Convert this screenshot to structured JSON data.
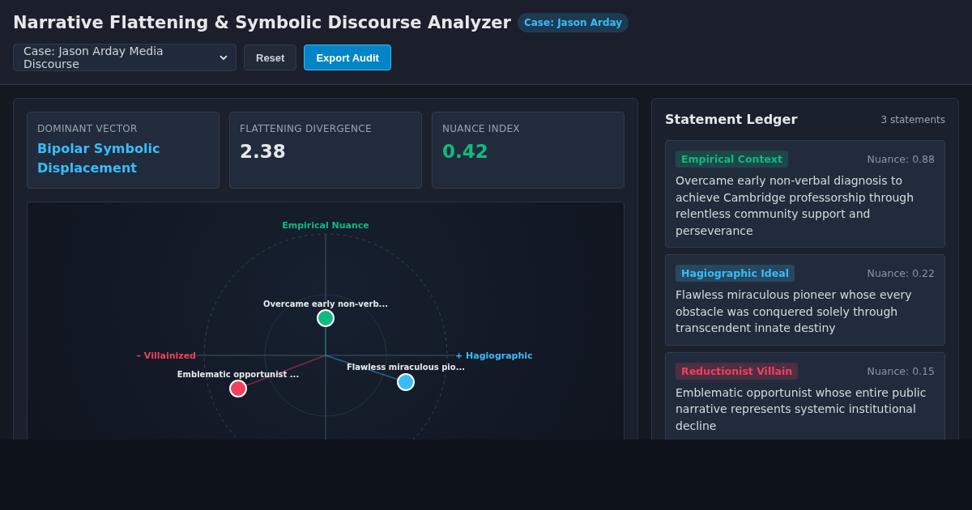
{
  "header": {
    "title": "Narrative Flattening & Symbolic Discourse Analyzer",
    "badge": "Case: Jason Arday"
  },
  "toolbar": {
    "case_select": "Case: Jason Arday Media Discourse",
    "buttons": [
      {
        "label": "Reset",
        "kind": "secondary"
      },
      {
        "label": "Export Audit",
        "kind": "primary"
      }
    ]
  },
  "metrics": [
    {
      "label": "DOMINANT VECTOR",
      "value": "Bipolar Symbolic Displacement",
      "kind": "text",
      "color": "#38bdf8"
    },
    {
      "label": "FLATTENING DIVERGENCE",
      "value": "2.38",
      "kind": "number",
      "color": "#e5e7eb"
    },
    {
      "label": "NUANCE INDEX",
      "value": "0.42",
      "kind": "number",
      "color": "#10b981"
    }
  ],
  "chart": {
    "axis_top": "Empirical Nuance",
    "axis_left": "– Villainized",
    "axis_right": "+ Hagiographic"
  },
  "ledger": {
    "title": "Statement Ledger",
    "count": "3 statements",
    "statements": [
      {
        "kind": "empirical",
        "tag": "Empirical Context",
        "nuance": "Nuance: 0.88",
        "color": "#10b981",
        "short_label": "Overcame early non-verb...",
        "text": "Overcame early non-verbal diagnosis to achieve Cambridge professorship through relentless community support and perseverance"
      },
      {
        "kind": "hagiographic",
        "tag": "Hagiographic Ideal",
        "nuance": "Nuance: 0.22",
        "color": "#38bdf8",
        "short_label": "Flawless miraculous pio...",
        "text": "Flawless miraculous pioneer whose every obstacle was conquered solely through transcendent innate destiny"
      },
      {
        "kind": "villain",
        "tag": "Reductionist Villain",
        "nuance": "Nuance: 0.15",
        "color": "#f43f5e",
        "short_label": "Emblematic opportunist ...",
        "text": "Emblematic opportunist whose entire public narrative represents systemic institutional decline"
      }
    ]
  }
}
